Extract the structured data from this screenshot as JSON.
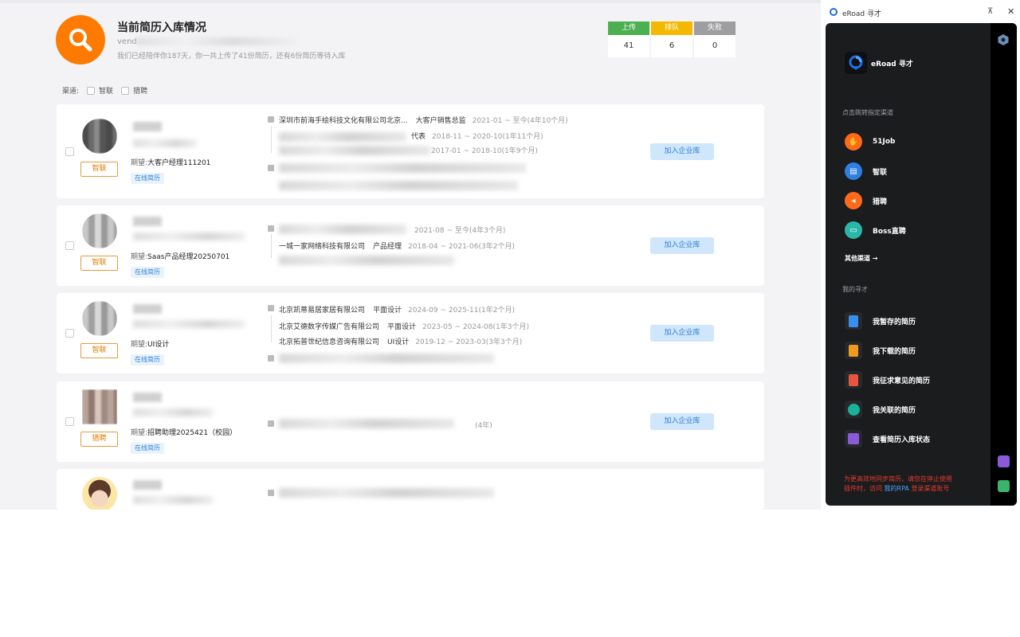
{
  "summary": {
    "title": "当前简历入库情况",
    "email_prefix": "vend",
    "description": "我们已经陪伴你187天，你一共上传了41份简历，还有6份简历等待入库",
    "stats": [
      {
        "label": "上传",
        "value": "41",
        "color": "#4caf50"
      },
      {
        "label": "排队",
        "value": "6",
        "color": "#f5b800"
      },
      {
        "label": "失败",
        "value": "0",
        "color": "#9e9e9e"
      }
    ]
  },
  "channel_filter": {
    "label": "渠道:",
    "options": [
      "智联",
      "猎聘"
    ]
  },
  "candidates": [
    {
      "source": "智联",
      "expect_label": "期望:",
      "expect": "大客户经理111201",
      "tag": "在线简历",
      "experiences": [
        {
          "company": "深圳市前海手绘科技文化有限公司北京...",
          "role": "大客户销售总监",
          "period": "2021-01 ~ 至今(4年10个月)"
        },
        {
          "company": "",
          "role": "代表",
          "period": "2018-11 ~ 2020-10(1年11个月)"
        },
        {
          "company": "",
          "role": "",
          "period": "2017-01 ~ 2018-10(1年9个月)"
        }
      ],
      "action": "加入企业库"
    },
    {
      "source": "智联",
      "expect_label": "期望:",
      "expect": "Saas产品经理20250701",
      "tag": "在线简历",
      "experiences": [
        {
          "company": "",
          "role": "",
          "period": "2021-08 ~ 至今(4年3个月)"
        },
        {
          "company": "一城一家网络科技有限公司",
          "role": "产品经理",
          "period": "2018-04 ~ 2021-06(3年2个月)"
        }
      ],
      "action": "加入企业库"
    },
    {
      "source": "智联",
      "expect_label": "期望:",
      "expect": "UI设计",
      "tag": "在线简历",
      "experiences": [
        {
          "company": "北京凯蒂易居家居有限公司",
          "role": "平面设计",
          "period": "2024-09 ~ 2025-11(1年2个月)"
        },
        {
          "company": "北京艾德数字传媒广告有限公司",
          "role": "平面设计",
          "period": "2023-05 ~ 2024-08(1年3个月)"
        },
        {
          "company": "北京拓普世纪信息咨询有限公司",
          "role": "UI设计",
          "period": "2019-12 ~ 2023-03(3年3个月)"
        }
      ],
      "action": "加入企业库"
    },
    {
      "source": "猎聘",
      "expect_label": "期望:",
      "expect": "招聘助理2025421（校园）",
      "tag": "在线简历",
      "experiences": [
        {
          "company": "",
          "role": "",
          "period": "(4年)"
        }
      ],
      "action": "加入企业库"
    }
  ],
  "panel": {
    "window_title": "eRoad 寻才",
    "brand": "eRoad 寻才",
    "section_channels": "点击跳转指定渠道",
    "channels": [
      {
        "label": "51Job",
        "icon": "job51-icon",
        "color": "#ff6a1a"
      },
      {
        "label": "智联",
        "icon": "zhilian-icon",
        "color": "#2f7fe0"
      },
      {
        "label": "猎聘",
        "icon": "liepin-icon",
        "color": "#ff6a1a"
      },
      {
        "label": "Boss直聘",
        "icon": "boss-icon",
        "color": "#2bb7a8"
      }
    ],
    "more_channels": "其他渠道 →",
    "section_mine": "我的寻才",
    "mine": [
      {
        "label": "我暂存的简历",
        "icon": "saved-resume-icon",
        "color": "#3a8ef0"
      },
      {
        "label": "我下载的简历",
        "icon": "download-resume-icon",
        "color": "#f29a1e"
      },
      {
        "label": "我征求意见的简历",
        "icon": "feedback-resume-icon",
        "color": "#e8553f"
      },
      {
        "label": "我关联的简历",
        "icon": "link-resume-icon",
        "color": "#18b29a"
      },
      {
        "label": "查看简历入库状态",
        "icon": "status-icon",
        "color": "#8a5ad9"
      }
    ],
    "warning_line1": "为更高效地同步简历，请您在停止使用",
    "warning_line2_prefix": "插件时，访问",
    "warning_link": "我的RPA",
    "warning_line2_suffix": "登录渠道账号"
  }
}
